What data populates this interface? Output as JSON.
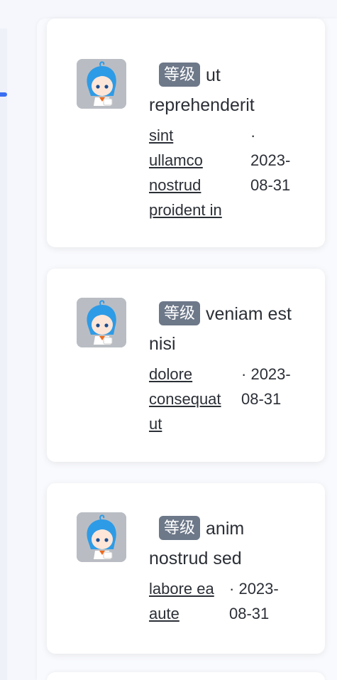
{
  "posts": [
    {
      "badge": "等级",
      "title": "ut reprehenderit",
      "author_lines": [
        "sint",
        "ullamco",
        "nostrud",
        "proident in"
      ],
      "dot": "·",
      "date_lines": [
        "2023-",
        "08-31"
      ],
      "avatar_icon": "anime-avatar-icon"
    },
    {
      "badge": "等级",
      "title": "veniam est nisi",
      "author_lines": [
        "dolore",
        "consequat",
        "ut"
      ],
      "dot": "·",
      "date_lines": [
        "2023-",
        "08-31"
      ],
      "avatar_icon": "anime-avatar-icon"
    },
    {
      "badge": "等级",
      "title": "anim nostrud sed",
      "author_lines": [
        "labore ea",
        "aute"
      ],
      "dot": "·",
      "date_lines": [
        "2023-",
        "08-31"
      ],
      "avatar_icon": "anime-avatar-icon"
    }
  ],
  "colors": {
    "badge_bg": "#6d7889",
    "accent": "#3a6ff2"
  }
}
